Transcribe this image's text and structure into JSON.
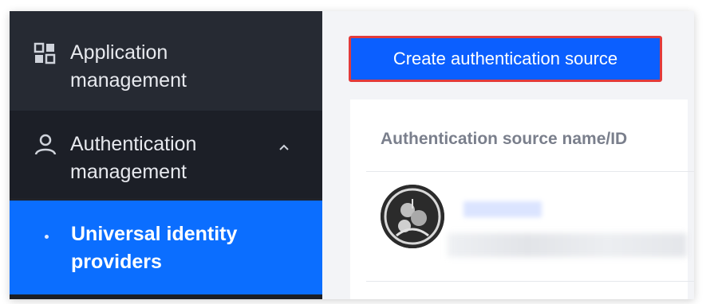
{
  "sidebar": {
    "items": [
      {
        "label_line1": "Application",
        "label_line2": "management",
        "icon": "grid-icon"
      },
      {
        "label_line1": "Authentication",
        "label_line2": "management",
        "icon": "user-icon",
        "expanded": true
      },
      {
        "label_line1": "Universal identity",
        "label_line2": "providers",
        "icon": "bullet-dot",
        "active": true
      }
    ]
  },
  "toolbar": {
    "create_label": "Create authentication source"
  },
  "table": {
    "column_header": "Authentication source name/ID"
  },
  "colors": {
    "sidebar_bg": "#1f222b",
    "active_bg": "#0b6eff",
    "primary_button": "#0b5fff",
    "highlight_border": "#e23b3b"
  }
}
